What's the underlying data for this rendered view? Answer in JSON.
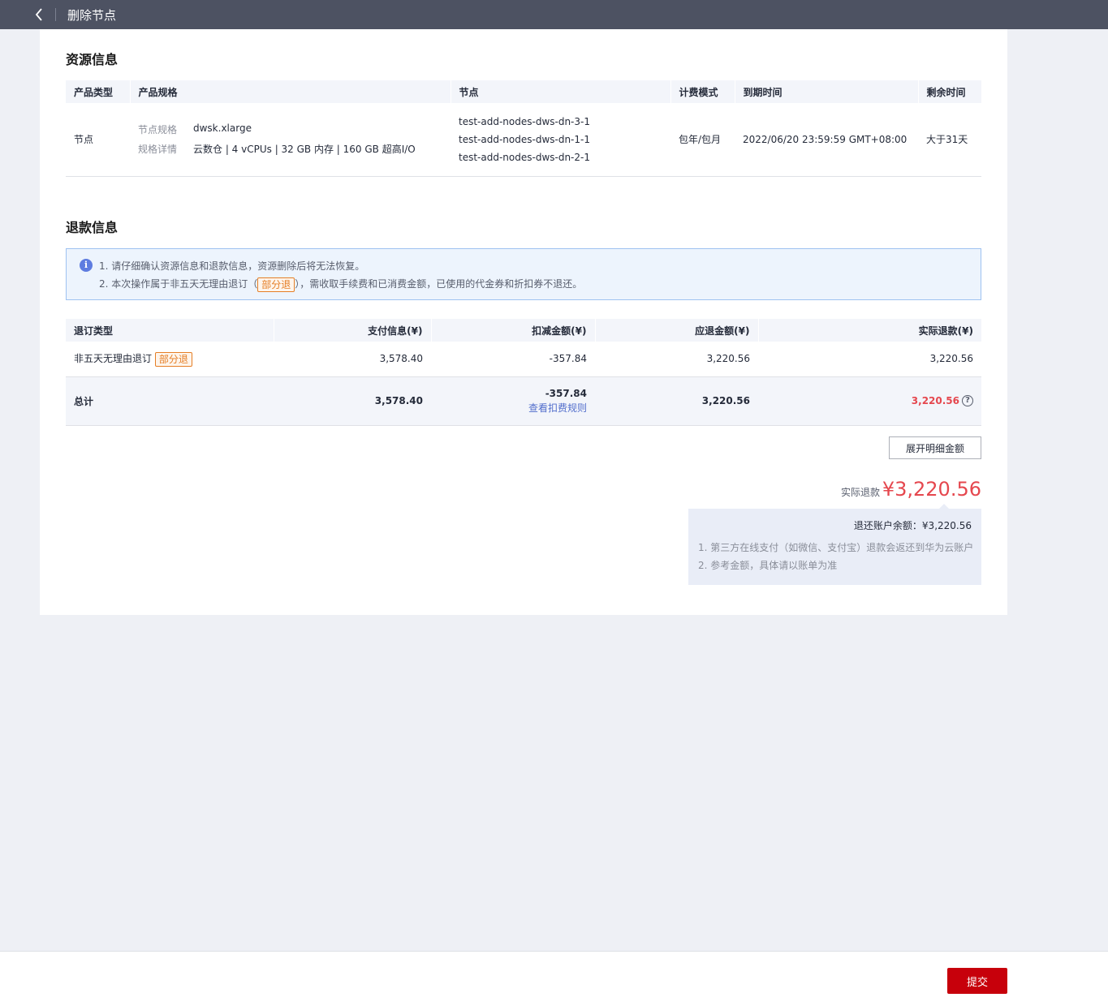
{
  "header": {
    "title": "删除节点",
    "back_icon": "chevron-left-icon"
  },
  "resource": {
    "section_title": "资源信息",
    "columns": [
      "产品类型",
      "产品规格",
      "节点",
      "计费模式",
      "到期时间",
      "剩余时间"
    ],
    "row": {
      "type": "节点",
      "spec_label": "节点规格",
      "spec_value": "dwsk.xlarge",
      "detail_label": "规格详情",
      "detail_value": "云数仓 | 4 vCPUs | 32 GB 内存 | 160 GB 超高I/O",
      "nodes": [
        "test-add-nodes-dws-dn-3-1",
        "test-add-nodes-dws-dn-1-1",
        "test-add-nodes-dws-dn-2-1"
      ],
      "billing": "包年/包月",
      "expire": "2022/06/20 23:59:59 GMT+08:00",
      "remaining": "大于31天"
    }
  },
  "refund": {
    "section_title": "退款信息",
    "notice": {
      "line1": "1. 请仔细确认资源信息和退款信息，资源删除后将无法恢复。",
      "line2_pre": "2. 本次操作属于非五天无理由退订（",
      "line2_tag": "部分退",
      "line2_post": "），需收取手续费和已消费金额，已使用的代金券和折扣券不退还。"
    },
    "columns": [
      "退订类型",
      "支付信息(¥)",
      "扣减金额(¥)",
      "应退金额(¥)",
      "实际退款(¥)"
    ],
    "row": {
      "type": "非五天无理由退订",
      "tag": "部分退",
      "paid": "3,578.40",
      "deduct": "-357.84",
      "due": "3,220.56",
      "actual": "3,220.56"
    },
    "total": {
      "label": "总计",
      "paid": "3,578.40",
      "deduct": "-357.84",
      "deduct_link": "查看扣费规则",
      "due": "3,220.56",
      "actual": "3,220.56"
    },
    "expand_button": "展开明细金额",
    "actual_label": "实际退款",
    "actual_amount": "¥3,220.56",
    "balance": "退还账户余额：¥3,220.56",
    "note1": "1. 第三方在线支付（如微信、支付宝）退款会返还到华为云账户",
    "note2": "2. 参考金额，具体请以账单为准"
  },
  "footer": {
    "submit": "提交"
  },
  "colors": {
    "topbar": "#4d5262",
    "accent_red": "#c7000b",
    "amount_red": "#e5474e",
    "link": "#526ecc",
    "tag_orange": "#e57e26"
  }
}
